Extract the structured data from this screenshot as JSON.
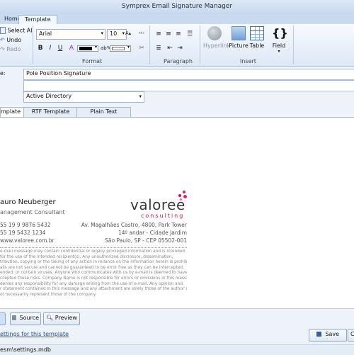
{
  "window": {
    "title": "Symprex Email Signature Manager"
  },
  "ribbon_tabs": [
    "Home",
    "Template"
  ],
  "ribbon": {
    "clipboard": {
      "select_all": "Select All",
      "undo": "Undo",
      "redo": "Redo"
    },
    "format": {
      "font": "Arial",
      "size": "10",
      "group_label": "Format"
    },
    "paragraph": {
      "group_label": "Paragraph"
    },
    "insert": {
      "group_label": "Insert",
      "hyperlink": "Hyperlink",
      "picture": "Picture",
      "table": "Table",
      "field": "Field"
    }
  },
  "form": {
    "name_label": "e:",
    "name_value": "Pole Position Signature",
    "source_value": "Active Directory",
    "tabs": [
      "mplate",
      "RTF Template",
      "Plain Text Template"
    ]
  },
  "signature": {
    "name": "auro Neuberger",
    "title": "anagement Consultant",
    "phone1": "55 19 9 9876 5432",
    "phone2": "55 19 5432 1234",
    "website": "www.valoree.com.br",
    "address1": "Av. Magalhães Castro, 4800, Park Tower",
    "address2": "14º andar - Cidade Jardim",
    "address3": "São Paulo, SP - CEP 05502-001",
    "logo_word": "valoree",
    "logo_sub": "consulting",
    "disclaimer": [
      "e-mail message may contain confidential or legally privileged information and is intended",
      "for the use of the intended recipient(s). Any unauthorized disclosure, dissemination,",
      "tribution, copying or the taking of any action in reliance on the information herein is prohibited.",
      "ails are not secure and cannot be guaranteed to be error free as they can be intercepted,",
      "ended, or contain viruses. Anyone who communicates with us by e-mail is deemed to have",
      "ccepted these risks. Company Name is not responsible for errors or omissions in this message",
      "denies any responsibility for any damage arising from the use of e-mail. Any opinion and",
      "r statement contained in this message and any attachment are solely those of the author and",
      "ot necessarily represent those of the company."
    ]
  },
  "bottom": {
    "source_button": "Source",
    "preview_button": "Preview",
    "settings_link": "ettings for this template",
    "save_button": "Save",
    "cancel_button": "Ca",
    "status_path": "esm\\settings.mdb"
  }
}
